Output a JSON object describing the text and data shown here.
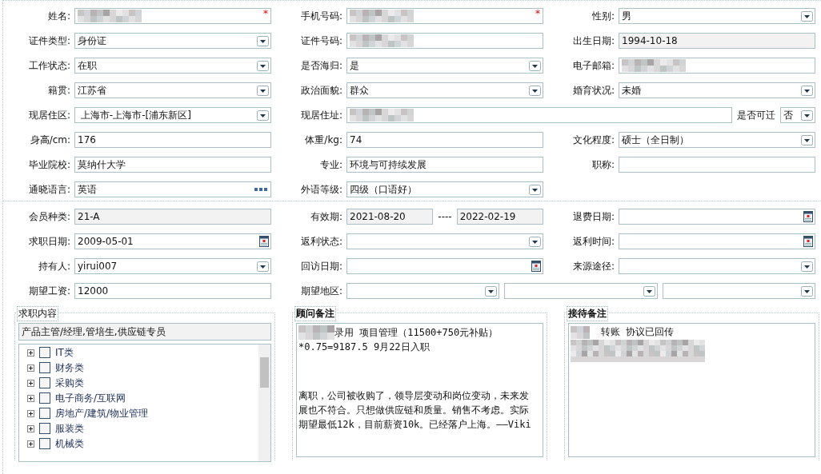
{
  "sections": [
    {
      "rows": [
        [
          {
            "label": "姓名:",
            "controls": [
              {
                "kind": "text",
                "redacted": true,
                "required_mark": "*"
              }
            ]
          },
          {
            "label": "手机号码:",
            "controls": [
              {
                "kind": "text",
                "redacted": true,
                "required_mark": "*"
              }
            ]
          },
          {
            "label": "性别:",
            "controls": [
              {
                "kind": "select",
                "value": "男"
              }
            ]
          }
        ],
        [
          {
            "label": "证件类型:",
            "controls": [
              {
                "kind": "select",
                "value": "身份证"
              }
            ]
          },
          {
            "label": "证件号码:",
            "controls": [
              {
                "kind": "text",
                "redacted": true
              }
            ]
          },
          {
            "label": "出生日期:",
            "controls": [
              {
                "kind": "text",
                "value": "1994-10-18",
                "readonly": true
              }
            ]
          }
        ],
        [
          {
            "label": "工作状态:",
            "controls": [
              {
                "kind": "select",
                "value": "在职"
              }
            ]
          },
          {
            "label": "是否海归:",
            "controls": [
              {
                "kind": "select",
                "value": "是"
              }
            ]
          },
          {
            "label": "电子邮箱:",
            "controls": [
              {
                "kind": "text",
                "redacted": true
              }
            ]
          }
        ],
        [
          {
            "label": "籍贯:",
            "controls": [
              {
                "kind": "select",
                "value": "江苏省"
              }
            ]
          },
          {
            "label": "政治面貌:",
            "controls": [
              {
                "kind": "select",
                "value": "群众"
              }
            ]
          },
          {
            "label": "婚育状况:",
            "controls": [
              {
                "kind": "select",
                "value": "未婚"
              }
            ]
          }
        ],
        [
          {
            "label": "现居住区:",
            "controls": [
              {
                "kind": "select",
                "value": " 上海市-上海市-[浦东新区]"
              }
            ]
          },
          {
            "label": "现居住址:",
            "wide": true,
            "controls": [
              {
                "kind": "text",
                "redacted": true
              },
              {
                "kind": "inline_label",
                "value": "是否可迁"
              },
              {
                "kind": "select",
                "value": "否",
                "small": true
              }
            ]
          }
        ],
        [
          {
            "label": "身高/cm:",
            "controls": [
              {
                "kind": "text",
                "value": "176"
              }
            ]
          },
          {
            "label": "体重/kg:",
            "controls": [
              {
                "kind": "text",
                "value": "74"
              }
            ]
          },
          {
            "label": "文化程度:",
            "controls": [
              {
                "kind": "select",
                "value": "硕士（全日制）"
              }
            ]
          }
        ],
        [
          {
            "label": "毕业院校:",
            "controls": [
              {
                "kind": "text",
                "value": "莫纳什大学"
              }
            ]
          },
          {
            "label": "专业:",
            "controls": [
              {
                "kind": "text",
                "value": "环境与可持续发展"
              }
            ]
          },
          {
            "label": "职称:",
            "controls": [
              {
                "kind": "text"
              }
            ]
          }
        ],
        [
          {
            "label": "通晓语言:",
            "controls": [
              {
                "kind": "lookup",
                "value": "英语"
              }
            ]
          },
          {
            "label": "外语等级:",
            "controls": [
              {
                "kind": "select",
                "value": "四级（口语好）"
              }
            ]
          }
        ]
      ]
    },
    {
      "rows": [
        [
          {
            "label": "会员种类:",
            "controls": [
              {
                "kind": "text",
                "value": "21-A",
                "readonly": true
              }
            ]
          },
          {
            "label": "有效期:",
            "controls": [
              {
                "kind": "text",
                "value": "2021-08-20",
                "readonly": true
              },
              {
                "kind": "inline_label",
                "value": "----"
              },
              {
                "kind": "text",
                "value": "2022-02-19",
                "readonly": true
              }
            ]
          },
          {
            "label": "退费日期:",
            "controls": [
              {
                "kind": "date"
              }
            ]
          }
        ],
        [
          {
            "label": "求职日期:",
            "controls": [
              {
                "kind": "date",
                "value": "2009-05-01"
              }
            ]
          },
          {
            "label": "返利状态:",
            "controls": [
              {
                "kind": "select"
              }
            ]
          },
          {
            "label": "返利时间:",
            "controls": [
              {
                "kind": "date"
              }
            ]
          }
        ],
        [
          {
            "label": "持有人:",
            "controls": [
              {
                "kind": "select",
                "value": "yirui007"
              }
            ]
          },
          {
            "label": "回访日期:",
            "controls": [
              {
                "kind": "date"
              }
            ]
          },
          {
            "label": "来源途径:",
            "controls": [
              {
                "kind": "select"
              }
            ]
          }
        ],
        [
          {
            "label": "期望工资:",
            "controls": [
              {
                "kind": "text",
                "value": "12000"
              }
            ]
          },
          {
            "label": "期望地区:",
            "wide": true,
            "controls": [
              {
                "kind": "select"
              },
              {
                "kind": "select"
              },
              {
                "kind": "select"
              }
            ]
          }
        ]
      ]
    }
  ],
  "job_panel": {
    "title": "求职内容",
    "summary": "产品主管/经理,管培生,供应链专员",
    "tree": [
      {
        "label": "IT类",
        "checked": false,
        "expanded": false
      },
      {
        "label": "财务类",
        "checked": false,
        "expanded": false
      },
      {
        "label": "采购类",
        "checked": false,
        "expanded": false
      },
      {
        "label": "电子商务/互联网",
        "checked": false,
        "expanded": false
      },
      {
        "label": "房地产/建筑/物业管理",
        "checked": false,
        "expanded": false
      },
      {
        "label": "服装类",
        "checked": false,
        "expanded": false
      },
      {
        "label": "机械类",
        "checked": false,
        "expanded": false
      }
    ]
  },
  "notes": [
    {
      "title": "顾问备注",
      "paragraphs": [
        {
          "lines": [
            {
              "text": "录用 项目管理（11500+750元补贴）",
              "redacted_prefix": true
            },
            {
              "text": "*0.75=9187.5  9月22日入职"
            }
          ]
        },
        {
          "lines": [
            {
              "text": "离职，公司被收购了，领导层变动和岗位变动，未来发"
            },
            {
              "text": "展也不符合。只想做供应链和质量。销售不考虑。实际"
            },
            {
              "text": "期望最低12k，目前薪资10k。已经落户上海。——Viki"
            }
          ]
        }
      ]
    },
    {
      "title": "接待备注",
      "paragraphs": [
        {
          "lines": [
            {
              "text": "转账 协议已回传",
              "redacted_prefix": true
            },
            {
              "redacted": true
            }
          ]
        }
      ]
    }
  ]
}
